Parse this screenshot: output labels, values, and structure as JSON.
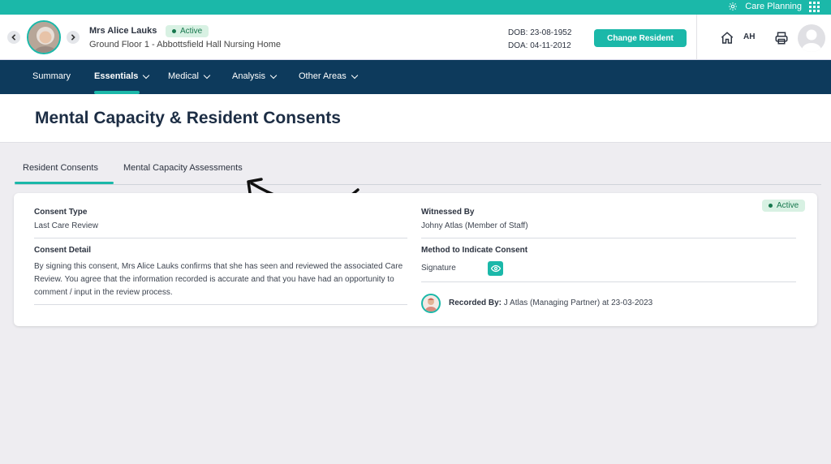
{
  "topbar": {
    "care_planning": "Care Planning"
  },
  "resident": {
    "name": "Mrs Alice Lauks",
    "status": "Active",
    "location": "Ground Floor 1 - Abbottsfield Hall Nursing Home",
    "dob": "DOB: 23-08-1952",
    "doa": "DOA: 04-11-2012",
    "change_button": "Change Resident"
  },
  "user": {
    "initials": "AH"
  },
  "nav": {
    "items": [
      {
        "label": "Summary"
      },
      {
        "label": "Essentials"
      },
      {
        "label": "Medical"
      },
      {
        "label": "Analysis"
      },
      {
        "label": "Other Areas"
      }
    ],
    "active": "Essentials"
  },
  "page": {
    "title": "Mental Capacity & Resident Consents"
  },
  "tabs": [
    {
      "label": "Resident Consents",
      "active": true
    },
    {
      "label": "Mental Capacity Assessments",
      "active": false
    }
  ],
  "consent": {
    "status": "Active",
    "consent_type_label": "Consent Type",
    "consent_type_value": "Last Care Review",
    "consent_detail_label": "Consent Detail",
    "consent_detail_value": "By signing this consent, Mrs Alice Lauks confirms that she has seen and reviewed the associated Care Review. You agree that the information recorded is accurate and that you have had an opportunity to comment / input in the review process.",
    "witnessed_by_label": "Witnessed By",
    "witnessed_by_value": "Johny Atlas (Member of Staff)",
    "method_label": "Method to Indicate Consent",
    "method_value": "Signature",
    "recorded_by_label": "Recorded By:",
    "recorded_by_value": "J Atlas (Managing Partner) at 23-03-2023"
  },
  "colors": {
    "accent": "#1bb8a9",
    "nav_bg": "#0d3a5c",
    "active_badge_bg": "#d8f1e3",
    "active_badge_text": "#16774d"
  }
}
